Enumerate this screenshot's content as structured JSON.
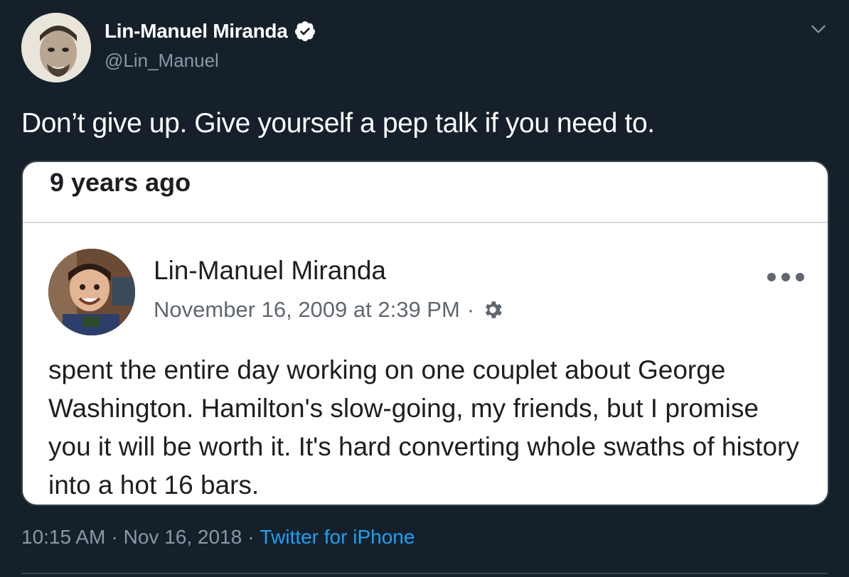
{
  "tweet": {
    "author_name": "Lin-Manuel Miranda",
    "author_handle": "@Lin_Manuel",
    "text": "Don’t give up. Give yourself a pep talk if you need to.",
    "time": "10:15 AM",
    "date": "Nov 16, 2018",
    "separator": "·",
    "source": "Twitter for iPhone"
  },
  "embed": {
    "memory_label": "9 years ago",
    "post_author": "Lin-Manuel Miranda",
    "post_date": "November 16, 2009 at 2:39 PM",
    "post_separator": "·",
    "post_body": "spent the entire day working on one couplet about George Washington. Hamilton's slow-going, my friends, but I promise you it will be worth it. It's hard converting whole swaths of history into a hot 16 bars."
  },
  "icons": {
    "verified": "verified-badge-icon",
    "caret": "chevron-down-icon",
    "gear": "gear-icon",
    "more": "more-horizontal-icon"
  },
  "colors": {
    "background": "#15202b",
    "accent": "#1da1f2",
    "secondary_text": "#8899a6"
  }
}
